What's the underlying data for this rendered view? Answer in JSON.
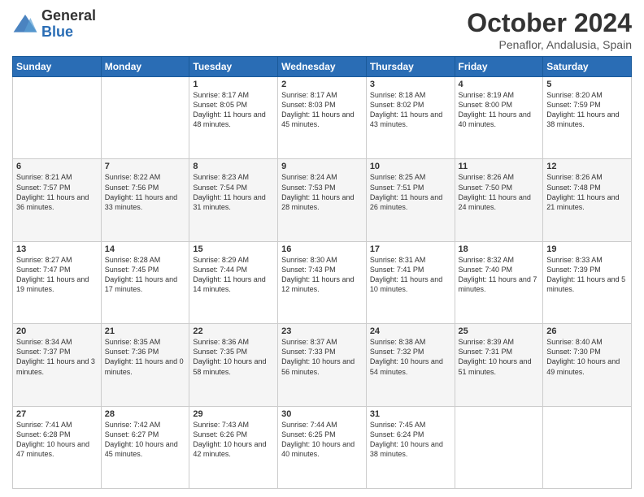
{
  "logo": {
    "general": "General",
    "blue": "Blue"
  },
  "title": {
    "month": "October 2024",
    "location": "Penaflor, Andalusia, Spain"
  },
  "headers": [
    "Sunday",
    "Monday",
    "Tuesday",
    "Wednesday",
    "Thursday",
    "Friday",
    "Saturday"
  ],
  "rows": [
    [
      {
        "day": "",
        "info": ""
      },
      {
        "day": "",
        "info": ""
      },
      {
        "day": "1",
        "info": "Sunrise: 8:17 AM\nSunset: 8:05 PM\nDaylight: 11 hours and 48 minutes."
      },
      {
        "day": "2",
        "info": "Sunrise: 8:17 AM\nSunset: 8:03 PM\nDaylight: 11 hours and 45 minutes."
      },
      {
        "day": "3",
        "info": "Sunrise: 8:18 AM\nSunset: 8:02 PM\nDaylight: 11 hours and 43 minutes."
      },
      {
        "day": "4",
        "info": "Sunrise: 8:19 AM\nSunset: 8:00 PM\nDaylight: 11 hours and 40 minutes."
      },
      {
        "day": "5",
        "info": "Sunrise: 8:20 AM\nSunset: 7:59 PM\nDaylight: 11 hours and 38 minutes."
      }
    ],
    [
      {
        "day": "6",
        "info": "Sunrise: 8:21 AM\nSunset: 7:57 PM\nDaylight: 11 hours and 36 minutes."
      },
      {
        "day": "7",
        "info": "Sunrise: 8:22 AM\nSunset: 7:56 PM\nDaylight: 11 hours and 33 minutes."
      },
      {
        "day": "8",
        "info": "Sunrise: 8:23 AM\nSunset: 7:54 PM\nDaylight: 11 hours and 31 minutes."
      },
      {
        "day": "9",
        "info": "Sunrise: 8:24 AM\nSunset: 7:53 PM\nDaylight: 11 hours and 28 minutes."
      },
      {
        "day": "10",
        "info": "Sunrise: 8:25 AM\nSunset: 7:51 PM\nDaylight: 11 hours and 26 minutes."
      },
      {
        "day": "11",
        "info": "Sunrise: 8:26 AM\nSunset: 7:50 PM\nDaylight: 11 hours and 24 minutes."
      },
      {
        "day": "12",
        "info": "Sunrise: 8:26 AM\nSunset: 7:48 PM\nDaylight: 11 hours and 21 minutes."
      }
    ],
    [
      {
        "day": "13",
        "info": "Sunrise: 8:27 AM\nSunset: 7:47 PM\nDaylight: 11 hours and 19 minutes."
      },
      {
        "day": "14",
        "info": "Sunrise: 8:28 AM\nSunset: 7:45 PM\nDaylight: 11 hours and 17 minutes."
      },
      {
        "day": "15",
        "info": "Sunrise: 8:29 AM\nSunset: 7:44 PM\nDaylight: 11 hours and 14 minutes."
      },
      {
        "day": "16",
        "info": "Sunrise: 8:30 AM\nSunset: 7:43 PM\nDaylight: 11 hours and 12 minutes."
      },
      {
        "day": "17",
        "info": "Sunrise: 8:31 AM\nSunset: 7:41 PM\nDaylight: 11 hours and 10 minutes."
      },
      {
        "day": "18",
        "info": "Sunrise: 8:32 AM\nSunset: 7:40 PM\nDaylight: 11 hours and 7 minutes."
      },
      {
        "day": "19",
        "info": "Sunrise: 8:33 AM\nSunset: 7:39 PM\nDaylight: 11 hours and 5 minutes."
      }
    ],
    [
      {
        "day": "20",
        "info": "Sunrise: 8:34 AM\nSunset: 7:37 PM\nDaylight: 11 hours and 3 minutes."
      },
      {
        "day": "21",
        "info": "Sunrise: 8:35 AM\nSunset: 7:36 PM\nDaylight: 11 hours and 0 minutes."
      },
      {
        "day": "22",
        "info": "Sunrise: 8:36 AM\nSunset: 7:35 PM\nDaylight: 10 hours and 58 minutes."
      },
      {
        "day": "23",
        "info": "Sunrise: 8:37 AM\nSunset: 7:33 PM\nDaylight: 10 hours and 56 minutes."
      },
      {
        "day": "24",
        "info": "Sunrise: 8:38 AM\nSunset: 7:32 PM\nDaylight: 10 hours and 54 minutes."
      },
      {
        "day": "25",
        "info": "Sunrise: 8:39 AM\nSunset: 7:31 PM\nDaylight: 10 hours and 51 minutes."
      },
      {
        "day": "26",
        "info": "Sunrise: 8:40 AM\nSunset: 7:30 PM\nDaylight: 10 hours and 49 minutes."
      }
    ],
    [
      {
        "day": "27",
        "info": "Sunrise: 7:41 AM\nSunset: 6:28 PM\nDaylight: 10 hours and 47 minutes."
      },
      {
        "day": "28",
        "info": "Sunrise: 7:42 AM\nSunset: 6:27 PM\nDaylight: 10 hours and 45 minutes."
      },
      {
        "day": "29",
        "info": "Sunrise: 7:43 AM\nSunset: 6:26 PM\nDaylight: 10 hours and 42 minutes."
      },
      {
        "day": "30",
        "info": "Sunrise: 7:44 AM\nSunset: 6:25 PM\nDaylight: 10 hours and 40 minutes."
      },
      {
        "day": "31",
        "info": "Sunrise: 7:45 AM\nSunset: 6:24 PM\nDaylight: 10 hours and 38 minutes."
      },
      {
        "day": "",
        "info": ""
      },
      {
        "day": "",
        "info": ""
      }
    ]
  ]
}
